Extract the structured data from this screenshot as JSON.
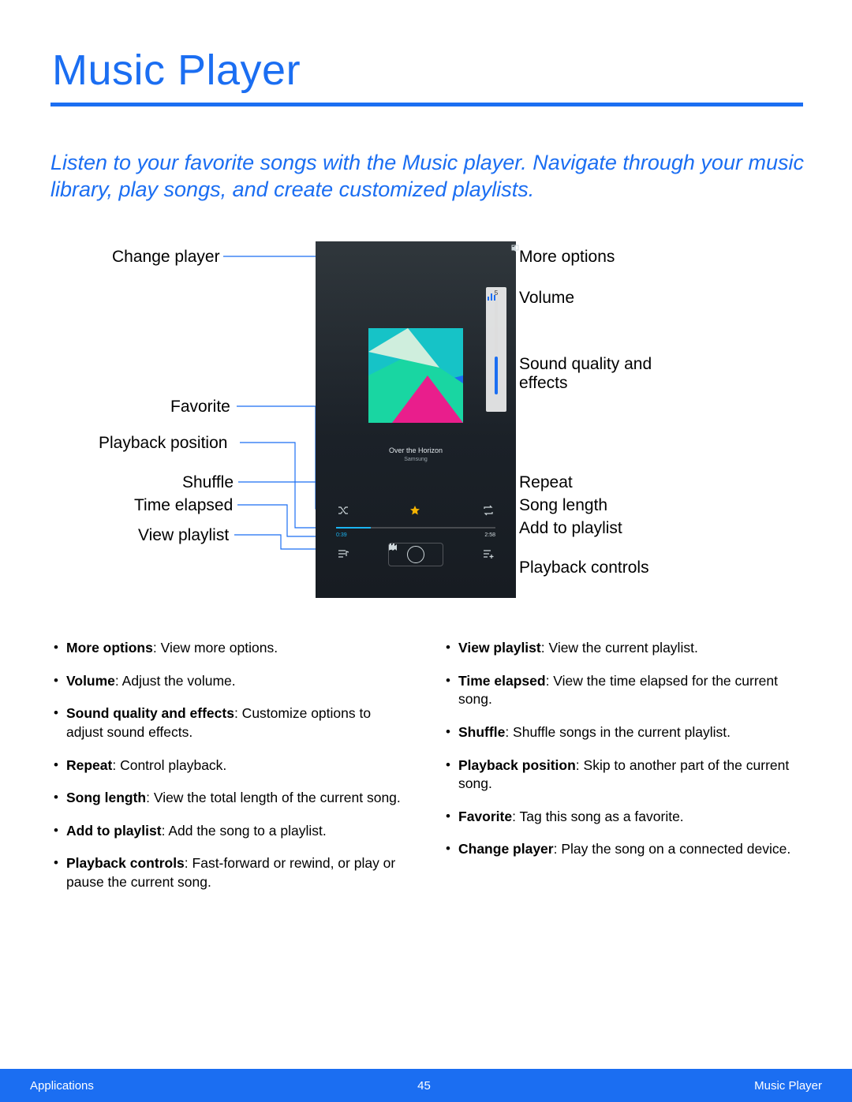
{
  "title": "Music Player",
  "intro": "Listen to your favorite songs with the Music player. Navigate through your music library, play songs, and create customized playlists.",
  "labels_left": {
    "change_player": "Change player",
    "favorite": "Favorite",
    "playback_position": "Playback position",
    "shuffle": "Shuffle",
    "time_elapsed": "Time elapsed",
    "view_playlist": "View playlist"
  },
  "labels_right": {
    "more_options": "More options",
    "volume": "Volume",
    "sound_quality": "Sound quality and effects",
    "repeat": "Repeat",
    "song_length": "Song length",
    "add_to_playlist": "Add to playlist",
    "playback_controls": "Playback controls"
  },
  "phone": {
    "volume_level": "5",
    "song_title": "Over the Horizon",
    "song_artist": "Samsung",
    "time_elapsed": "0:39",
    "time_total": "2:58"
  },
  "desc_left": [
    {
      "b": "More options",
      "t": ": View more options."
    },
    {
      "b": "Volume",
      "t": ": Adjust the volume."
    },
    {
      "b": "Sound quality and effects",
      "t": ": Customize options to adjust sound effects."
    },
    {
      "b": "Repeat",
      "t": ": Control playback."
    },
    {
      "b": "Song length",
      "t": ": View the total length of the current song."
    },
    {
      "b": "Add to playlist",
      "t": ": Add the song to a playlist."
    },
    {
      "b": "Playback controls",
      "t": ": Fast-forward or rewind, or play or pause the current song."
    }
  ],
  "desc_right": [
    {
      "b": "View playlist",
      "t": ": View the current playlist."
    },
    {
      "b": "Time elapsed",
      "t": ": View the time elapsed for the current song."
    },
    {
      "b": "Shuffle",
      "t": ": Shuffle songs in the current playlist."
    },
    {
      "b": "Playback position",
      "t": ": Skip to another part of the current song."
    },
    {
      "b": "Favorite",
      "t": ": Tag this song as a favorite."
    },
    {
      "b": "Change player",
      "t": ": Play the song on a connected device."
    }
  ],
  "footer": {
    "left": "Applications",
    "center": "45",
    "right": "Music Player"
  },
  "colors": {
    "accent": "#1b6ef2"
  }
}
